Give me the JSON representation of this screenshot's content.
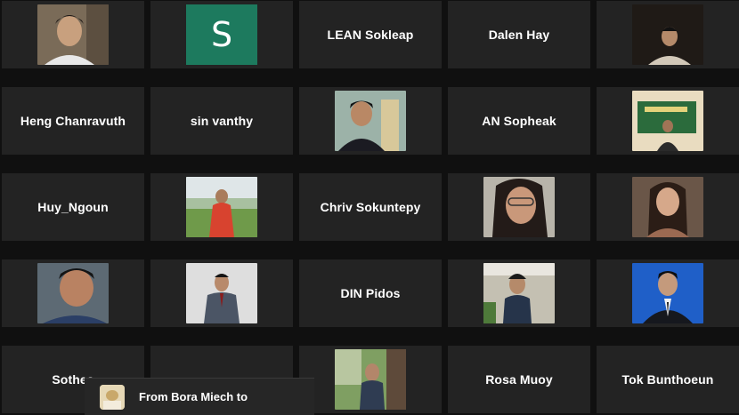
{
  "participants": [
    {
      "name": "",
      "type": "video",
      "color": "#6b5a48"
    },
    {
      "name": "S",
      "type": "avatar",
      "color": "#1d7a5e"
    },
    {
      "name": "LEAN Sokleap",
      "type": "name"
    },
    {
      "name": "Dalen Hay",
      "type": "name"
    },
    {
      "name": "",
      "type": "video",
      "color": "#2a2520"
    },
    {
      "name": "Heng Chanravuth",
      "type": "name"
    },
    {
      "name": "sin vanthy",
      "type": "name"
    },
    {
      "name": "",
      "type": "video",
      "color": "#8fa59c"
    },
    {
      "name": "AN Sopheak",
      "type": "name"
    },
    {
      "name": "",
      "type": "video",
      "color": "#c9b48a"
    },
    {
      "name": "Huy_Ngoun",
      "type": "name"
    },
    {
      "name": "",
      "type": "video",
      "color": "#7fa260"
    },
    {
      "name": "Chriv Sokuntepy",
      "type": "name"
    },
    {
      "name": "",
      "type": "video",
      "color": "#a8a5a0"
    },
    {
      "name": "",
      "type": "video",
      "color": "#5d4a3e"
    },
    {
      "name": "",
      "type": "video",
      "color": "#5a6670"
    },
    {
      "name": "",
      "type": "video",
      "color": "#dcdcdc"
    },
    {
      "name": "DIN Pidos",
      "type": "name"
    },
    {
      "name": "",
      "type": "video",
      "color": "#b7b3a4"
    },
    {
      "name": "",
      "type": "video",
      "color": "#1f5fc8"
    },
    {
      "name": "Sotheа",
      "type": "name"
    },
    {
      "name": "",
      "type": "name"
    },
    {
      "name": "",
      "type": "video",
      "color": "#6d8f55"
    },
    {
      "name": "Rosa Muoy",
      "type": "name"
    },
    {
      "name": "Tok Bunthoeun",
      "type": "name"
    }
  ],
  "chat": {
    "preview": "From Bora Miech to"
  }
}
